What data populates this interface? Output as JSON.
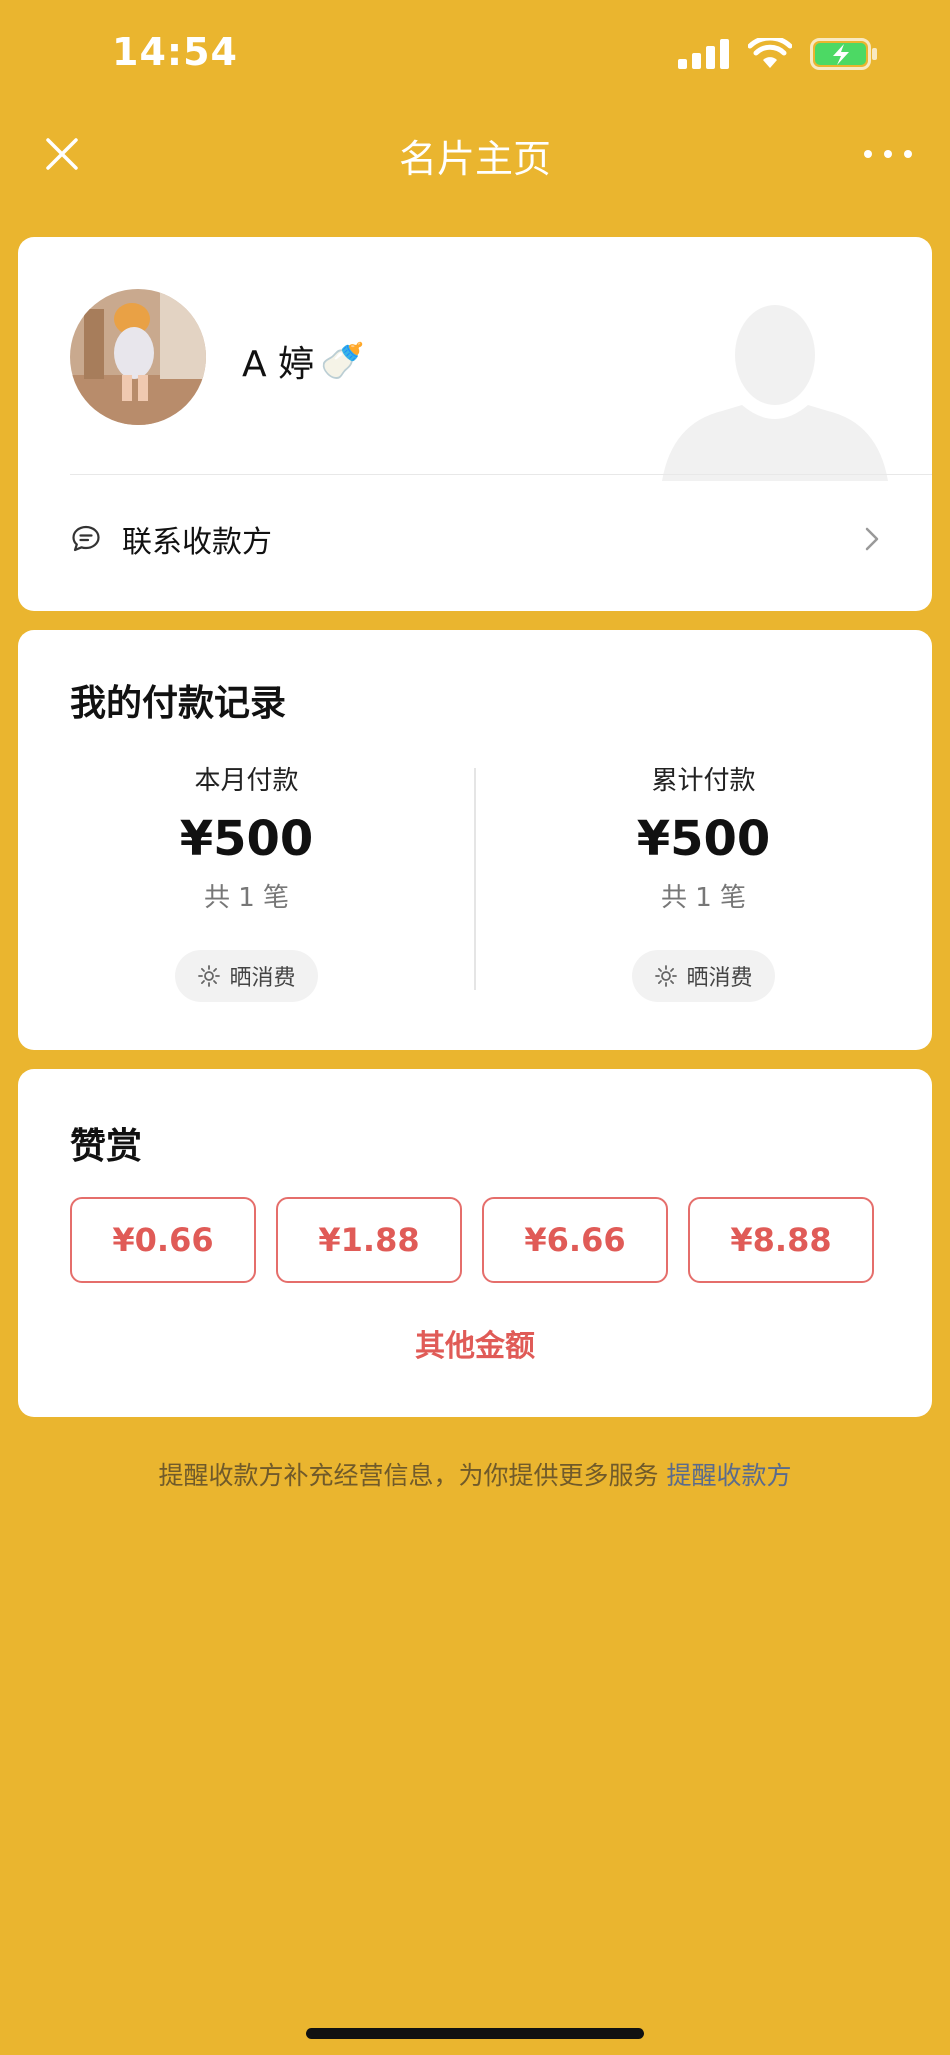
{
  "status_bar": {
    "time": "14:54",
    "icons": [
      "signal-icon",
      "wifi-icon",
      "battery-charging-icon"
    ]
  },
  "nav": {
    "title": "名片主页",
    "close_icon": "close-icon",
    "more_icon": "more-icon"
  },
  "profile": {
    "name": "A 婷",
    "name_emoji": "🍼",
    "contact_label": "联系收款方",
    "contact_icon": "chat-bubble-icon"
  },
  "records": {
    "title": "我的付款记录",
    "monthly": {
      "label": "本月付款",
      "value": "¥500",
      "count": "共 1 笔",
      "share_label": "晒消费"
    },
    "total": {
      "label": "累计付款",
      "value": "¥500",
      "count": "共 1 笔",
      "share_label": "晒消费"
    }
  },
  "reward": {
    "title": "赞赏",
    "amounts": [
      "¥0.66",
      "¥1.88",
      "¥6.66",
      "¥8.88"
    ],
    "other_label": "其他金额"
  },
  "footer": {
    "note": "提醒收款方补充经营信息，为你提供更多服务",
    "link": "提醒收款方"
  },
  "colors": {
    "background": "#EAB52F",
    "accent_red": "#E05B57",
    "link_blue": "#5A6B8C",
    "battery_green": "#4CD964"
  }
}
